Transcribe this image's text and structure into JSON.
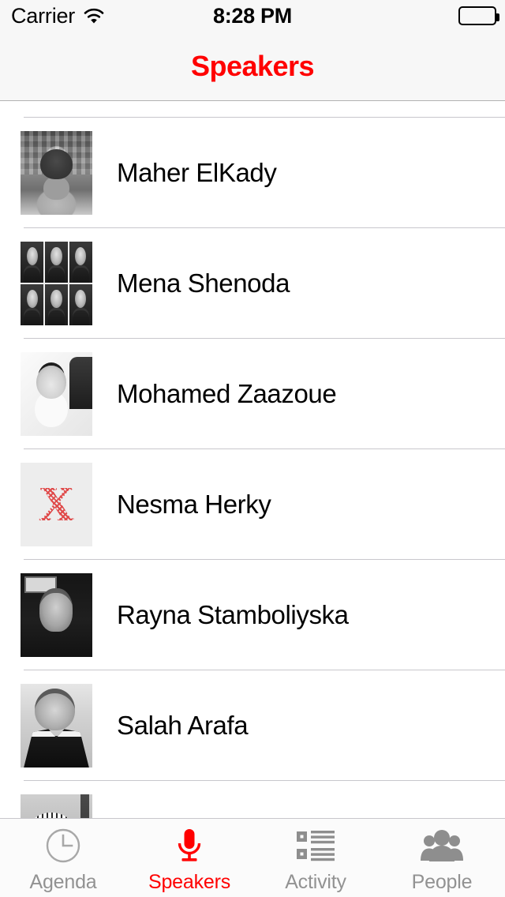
{
  "status_bar": {
    "carrier": "Carrier",
    "wifi_icon": "wifi-icon",
    "time": "8:28 PM",
    "battery_icon": "battery-full-icon"
  },
  "nav_bar": {
    "title": "Speakers",
    "title_color": "#FF0000",
    "background": "#f7f7f7"
  },
  "list": {
    "rows": [
      {
        "name": "Maher ElKady",
        "thumbnail": "speaker-photo-maher-elkady"
      },
      {
        "name": "Mena Shenoda",
        "thumbnail": "speaker-photo-mena-shenoda"
      },
      {
        "name": "Mohamed Zaazoue",
        "thumbnail": "speaker-photo-mohamed-zaazoue"
      },
      {
        "name": "Nesma Herky",
        "thumbnail": "speaker-photo-nesma-herky"
      },
      {
        "name": "Rayna Stamboliyska",
        "thumbnail": "speaker-photo-rayna-stamboliyska"
      },
      {
        "name": "Salah Arafa",
        "thumbnail": "speaker-photo-salah-arafa"
      },
      {
        "name": "",
        "thumbnail": "speaker-photo-partial"
      }
    ]
  },
  "tab_bar": {
    "active_color": "#FF0000",
    "inactive_color": "#929292",
    "items": [
      {
        "label": "Agenda",
        "icon": "clock-icon",
        "active": false
      },
      {
        "label": "Speakers",
        "icon": "microphone-icon",
        "active": true
      },
      {
        "label": "Activity",
        "icon": "list-icon",
        "active": false
      },
      {
        "label": "People",
        "icon": "people-icon",
        "active": false
      }
    ]
  }
}
